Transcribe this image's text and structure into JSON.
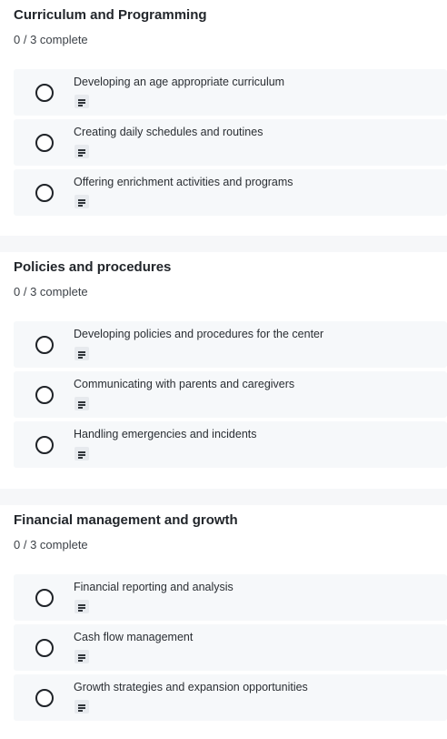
{
  "sections": [
    {
      "title": "Curriculum and Programming",
      "progress": "0 / 3 complete",
      "items": [
        {
          "label": "Developing an age appropriate curriculum",
          "icon": "notes-icon",
          "checked": false
        },
        {
          "label": "Creating daily schedules and routines",
          "icon": "notes-icon",
          "checked": false
        },
        {
          "label": "Offering enrichment activities and programs",
          "icon": "notes-icon",
          "checked": false
        }
      ]
    },
    {
      "title": "Policies and procedures",
      "progress": "0 / 3 complete",
      "items": [
        {
          "label": "Developing policies and procedures for the center",
          "icon": "notes-icon",
          "checked": false
        },
        {
          "label": "Communicating with parents and caregivers",
          "icon": "notes-icon",
          "checked": false
        },
        {
          "label": "Handling emergencies and incidents",
          "icon": "notes-icon",
          "checked": false
        }
      ]
    },
    {
      "title": "Financial management and growth",
      "progress": "0 / 3 complete",
      "items": [
        {
          "label": "Financial reporting and analysis",
          "icon": "notes-icon",
          "checked": false
        },
        {
          "label": "Cash flow management",
          "icon": "notes-icon",
          "checked": false
        },
        {
          "label": "Growth strategies and expansion opportunities",
          "icon": "notes-icon",
          "checked": false
        }
      ]
    }
  ],
  "colors": {
    "item_background": "#f6f8fa",
    "divider": "#f6f7f9",
    "text": "#22262b"
  }
}
